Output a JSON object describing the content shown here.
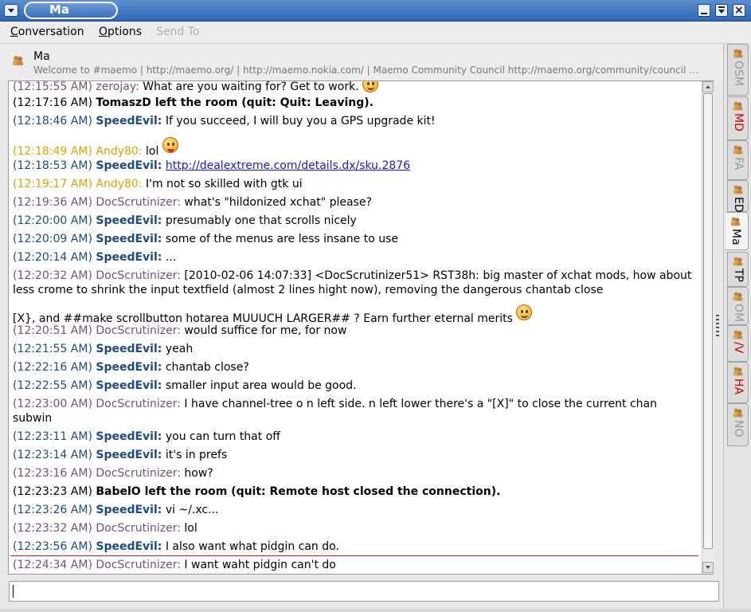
{
  "window": {
    "title": "Ma"
  },
  "menu": {
    "conversation": {
      "accel": "C",
      "rest": "onversation"
    },
    "options": {
      "accel": "O",
      "rest": "ptions"
    },
    "send_to": "Send To"
  },
  "header": {
    "name": "Ma",
    "topic": "Welcome to #maemo | http://maemo.org/ | http://maemo.nokia.com/ | Maemo Community Council http://maemo.org/community/council …"
  },
  "messages": [
    {
      "time": "(12:15:55 AM)",
      "nick": "zerojay:",
      "text": "What are you waiting for? Get to work."
    },
    {
      "time": "(12:17:16 AM)",
      "text": "TomaszD left the room (quit: Quit: Leaving)."
    },
    {
      "time": "(12:18:46 AM)",
      "nick": "SpeedEvil:",
      "text": "If you succeed, I will buy you a GPS upgrade kit!"
    },
    {
      "time": "(12:18:49 AM)",
      "nick": "Andy80:",
      "text": "lol"
    },
    {
      "time": "(12:18:53 AM)",
      "nick": "SpeedEvil:",
      "text": "http://dealextreme.com/details.dx/sku.2876"
    },
    {
      "time": "(12:19:17 AM)",
      "nick": "Andy80:",
      "text": "I'm not so skilled with gtk ui"
    },
    {
      "time": "(12:19:36 AM)",
      "nick": "DocScrutinizer:",
      "text": "what's \"hildonized xchat\" please?"
    },
    {
      "time": "(12:20:00 AM)",
      "nick": "SpeedEvil:",
      "text": "presumably one that scrolls nicely"
    },
    {
      "time": "(12:20:09 AM)",
      "nick": "SpeedEvil:",
      "text": "some of the menus are less insane to use"
    },
    {
      "time": "(12:20:14 AM)",
      "nick": "SpeedEvil:",
      "text": "..."
    },
    {
      "time": "(12:20:32 AM)",
      "nick": "DocScrutinizer:",
      "text": "[2010-02-06 14:07:33] <DocScrutinizer51> RST38h: big master of xchat mods, how about less crome to shrink the input textfield (almost 2 lines hight now), removing the dangerous chantab close",
      "text2": "[X}, and ##make scrollbutton hotarea MUUUCH LARGER## ? Earn further eternal merits"
    },
    {
      "time": "(12:20:51 AM)",
      "nick": "DocScrutinizer:",
      "text": "would suffice for me, for now"
    },
    {
      "time": "(12:21:55 AM)",
      "nick": "SpeedEvil:",
      "text": "yeah"
    },
    {
      "time": "(12:22:16 AM)",
      "nick": "SpeedEvil:",
      "text": "chantab close?"
    },
    {
      "time": "(12:22:55 AM)",
      "nick": "SpeedEvil:",
      "text": "smaller input area would be good."
    },
    {
      "time": "(12:23:00 AM)",
      "nick": "DocScrutinizer:",
      "text": "I have channel-tree o n left side. n  left lower there's a \"[X]\" to close the current chan subwin"
    },
    {
      "time": "(12:23:11 AM)",
      "nick": "SpeedEvil:",
      "text": "you can turn that off"
    },
    {
      "time": "(12:23:14 AM)",
      "nick": "SpeedEvil:",
      "text": "it's in prefs"
    },
    {
      "time": "(12:23:16 AM)",
      "nick": "DocScrutinizer:",
      "text": "how?"
    },
    {
      "time": "(12:23:23 AM)",
      "text": "BabelO left the room (quit: Remote host closed the connection)."
    },
    {
      "time": "(12:23:26 AM)",
      "nick": "SpeedEvil:",
      "text": "vi ~/.xc..."
    },
    {
      "time": "(12:23:32 AM)",
      "nick": "DocScrutinizer:",
      "text": "lol"
    },
    {
      "time": "(12:23:56 AM)",
      "nick": "SpeedEvil:",
      "text": "I also want what pidgin can do."
    },
    {
      "time": "(12:24:34 AM)",
      "nick": "DocScrutinizer:",
      "text": "I want waht pidgin can't do"
    }
  ],
  "input": {
    "value": ""
  },
  "tabs": [
    {
      "label": "OSM",
      "color": "#999999"
    },
    {
      "label": "MD",
      "color": "#cc0000"
    },
    {
      "label": "FA",
      "color": "#999999"
    },
    {
      "label": "ED",
      "color": "#000000"
    },
    {
      "label": "Ma",
      "color": "#000000",
      "active": true
    },
    {
      "label": "TP",
      "color": "#000000"
    },
    {
      "label": "OM",
      "color": "#999999"
    },
    {
      "label": "/V",
      "color": "#cc0000"
    },
    {
      "label": "HA",
      "color": "#cc0000"
    },
    {
      "label": "NO",
      "color": "#999999"
    }
  ],
  "colors": {
    "speedevil": "#204a87",
    "docscrutinizer": "#75507b",
    "andy80": "#e1a200",
    "unread_marker": "#bb2222"
  },
  "icons": {
    "smiley": "smiley-icon",
    "tongue": "tongue-smiley-icon",
    "chat": "chat-people-icon"
  }
}
